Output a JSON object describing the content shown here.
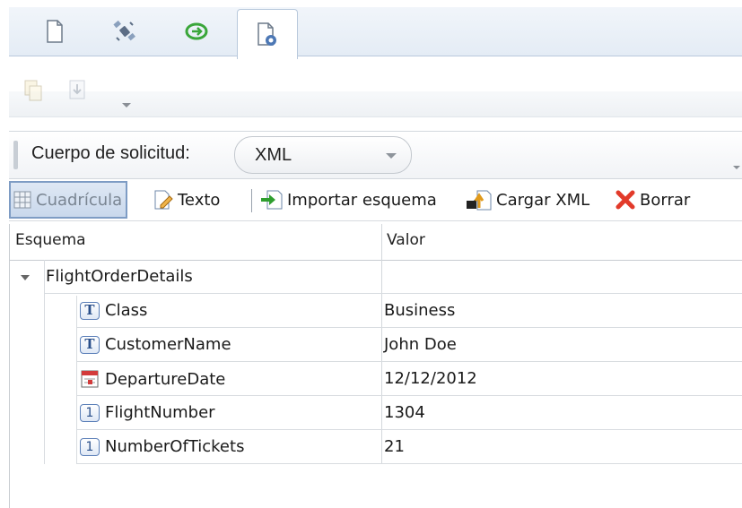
{
  "tabs": [
    {
      "icon": "document-icon",
      "active": false
    },
    {
      "icon": "satellite-icon",
      "active": false
    },
    {
      "icon": "green-cycle-icon",
      "active": false
    },
    {
      "icon": "document-settings-icon",
      "active": true
    }
  ],
  "disabled_toolbar": {
    "icons": [
      "copy-icon",
      "download-icon"
    ]
  },
  "body_bar": {
    "label": "Cuerpo de solicitud:",
    "format_selected": "XML"
  },
  "grid_toolbar": {
    "grid_label": "Cuadrícula",
    "text_label": "Texto",
    "import_schema_label": "Importar esquema",
    "load_xml_label": "Cargar XML",
    "delete_label": "Borrar"
  },
  "table": {
    "headers": {
      "schema": "Esquema",
      "value": "Valor"
    },
    "root": {
      "name": "FlightOrderDetails",
      "value": ""
    },
    "rows": [
      {
        "name": "Class",
        "type_icon": "text-type-icon",
        "value": "Business"
      },
      {
        "name": "CustomerName",
        "type_icon": "text-type-icon",
        "value": "John Doe"
      },
      {
        "name": "DepartureDate",
        "type_icon": "date-type-icon",
        "value": "12/12/2012"
      },
      {
        "name": "FlightNumber",
        "type_icon": "number-type-icon",
        "value": "1304"
      },
      {
        "name": "NumberOfTickets",
        "type_icon": "number-type-icon",
        "value": "21"
      }
    ]
  },
  "colors": {
    "accent": "#7e9cc4",
    "delete_red": "#e23a2a",
    "import_green": "#2f9e2f"
  }
}
